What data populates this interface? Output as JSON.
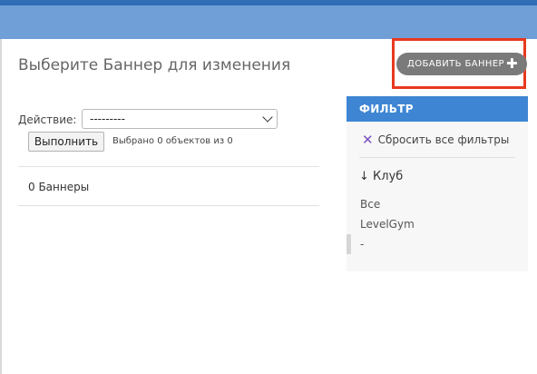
{
  "header": {
    "title": "Выберите Баннер для изменения",
    "add_button_label": "ДОБАВИТЬ БАННЕР",
    "add_button_icon": "plus-icon",
    "highlight_color": "#e8391f"
  },
  "actions": {
    "label": "Действие:",
    "select_value": "---------",
    "run_button_label": "Выполнить",
    "selected_text": "Выбрано 0 объектов из 0"
  },
  "results": {
    "count_text": "0 Баннеры"
  },
  "filter": {
    "header": "ФИЛЬТР",
    "reset_label": "Сбросить все фильтры",
    "reset_icon": "x",
    "group_title": "↓ Клуб",
    "options": [
      "Все",
      "LevelGym",
      "-"
    ]
  },
  "colors": {
    "topbar": "#6f9fd6",
    "filter_header": "#3e86d3"
  }
}
